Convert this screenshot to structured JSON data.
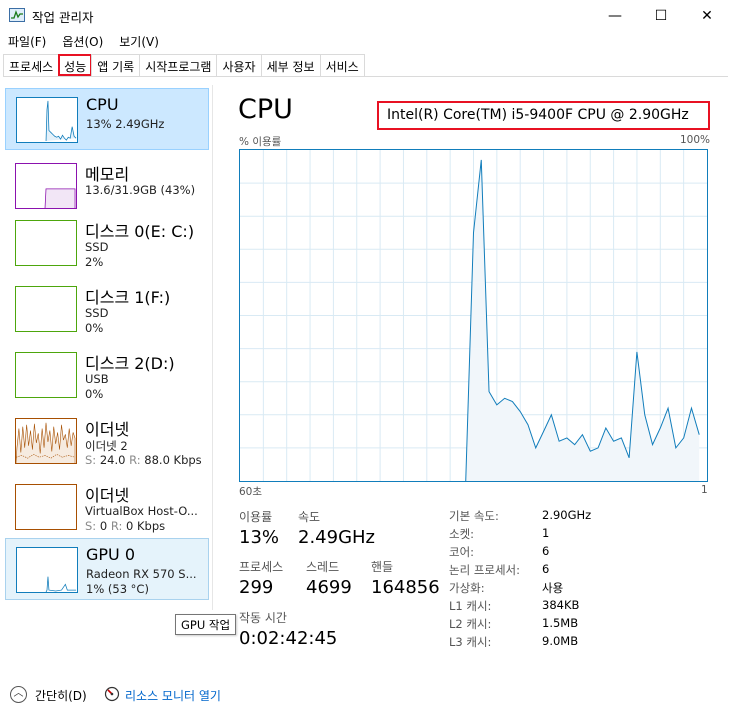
{
  "window": {
    "title": "작업 관리자",
    "minimize": "—",
    "maximize": "☐",
    "close": "✕"
  },
  "menu": [
    "파일(F)",
    "옵션(O)",
    "보기(V)"
  ],
  "tabs": [
    "프로세스",
    "성능",
    "앱 기록",
    "시작프로그램",
    "사용자",
    "세부 정보",
    "서비스"
  ],
  "active_tab": "성능",
  "sidebar": {
    "items": [
      {
        "name": "CPU",
        "line1": "13% 2.49GHz",
        "line2": "",
        "color": "#117dbb"
      },
      {
        "name": "메모리",
        "line1": "13.6/31.9GB (43%)",
        "line2": "",
        "color": "#8b12ae"
      },
      {
        "name": "디스크 0(E: C:)",
        "line1": "SSD",
        "line2": "2%",
        "color": "#4da60c"
      },
      {
        "name": "디스크 1(F:)",
        "line1": "SSD",
        "line2": "0%",
        "color": "#4da60c"
      },
      {
        "name": "디스크 2(D:)",
        "line1": "USB",
        "line2": "0%",
        "color": "#4da60c"
      },
      {
        "name": "이더넷",
        "line1": "이더넷 2",
        "line2_s": "S:",
        "line2_sv": "24.0",
        "line2_r": "R:",
        "line2_rv": "88.0 Kbps",
        "color": "#a74f01"
      },
      {
        "name": "이더넷",
        "line1": "VirtualBox Host-O...",
        "line2_s": "S:",
        "line2_sv": "0",
        "line2_r": "R:",
        "line2_rv": "0 Kbps",
        "color": "#a74f01"
      },
      {
        "name": "GPU 0",
        "line1": "Radeon RX 570 S...",
        "line2": "1% (53 °C)",
        "color": "#117dbb"
      }
    ]
  },
  "main": {
    "title": "CPU",
    "model": "Intel(R) Core(TM) i5-9400F CPU @ 2.90GHz",
    "axis_top_left": "% 이용률",
    "axis_top_right": "100%",
    "axis_bottom_left": "60초",
    "axis_bottom_right": "1"
  },
  "stats": {
    "util_label": "이용률",
    "util_value": "13%",
    "speed_label": "속도",
    "speed_value": "2.49GHz",
    "proc_label": "프로세스",
    "proc_value": "299",
    "thread_label": "스레드",
    "thread_value": "4699",
    "handle_label": "핸들",
    "handle_value": "164856",
    "uptime_label": "작동 시간",
    "uptime_value": "0:02:42:45"
  },
  "specs": [
    {
      "label": "기본 속도:",
      "value": "2.90GHz"
    },
    {
      "label": "소켓:",
      "value": "1"
    },
    {
      "label": "코어:",
      "value": "6"
    },
    {
      "label": "논리 프로세서:",
      "value": "6"
    },
    {
      "label": "가상화:",
      "value": "사용"
    },
    {
      "label": "L1 캐시:",
      "value": "384KB"
    },
    {
      "label": "L2 캐시:",
      "value": "1.5MB"
    },
    {
      "label": "L3 캐시:",
      "value": "9.0MB"
    }
  ],
  "tooltip": "GPU 작업",
  "footer": {
    "fewer": "간단히(D)",
    "resmon": "리소스 모니터 열기"
  },
  "chart_data": {
    "type": "area",
    "x_label": "60초",
    "x_range": [
      60,
      0
    ],
    "ylim": [
      0,
      100
    ],
    "grid": true,
    "color": "#117dbb",
    "x": [
      60,
      59,
      58,
      57,
      56,
      55,
      54,
      53,
      52,
      51,
      50,
      49,
      48,
      47,
      46,
      45,
      44,
      43,
      42,
      41,
      40,
      39,
      38,
      37,
      36,
      35,
      34,
      33,
      32,
      31,
      31,
      30,
      29,
      28,
      27,
      26,
      25,
      24,
      23,
      22,
      21,
      20,
      19,
      18,
      17,
      16,
      15,
      14,
      13,
      12,
      11,
      10,
      9,
      8,
      7,
      6,
      5,
      4,
      3,
      2,
      1,
      0
    ],
    "values": [
      null,
      null,
      null,
      null,
      null,
      null,
      null,
      null,
      null,
      null,
      null,
      null,
      null,
      null,
      null,
      null,
      null,
      null,
      null,
      null,
      null,
      null,
      null,
      null,
      null,
      null,
      null,
      null,
      null,
      null,
      0,
      75,
      97,
      27,
      23,
      25,
      24,
      21,
      17,
      10,
      15,
      20,
      12,
      13,
      11,
      14,
      9,
      10,
      16,
      12,
      13,
      7,
      39,
      20,
      11,
      16,
      22,
      10,
      13,
      22,
      14
    ]
  }
}
